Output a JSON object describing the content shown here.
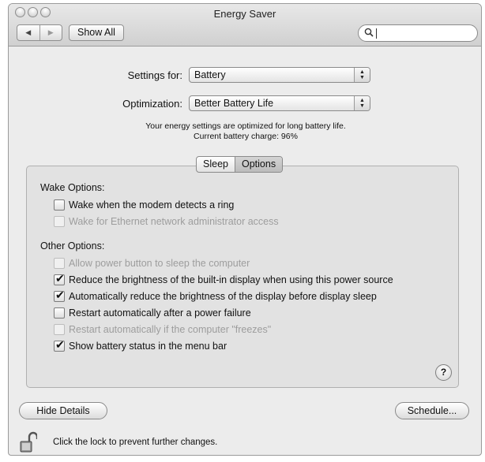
{
  "window": {
    "title": "Energy Saver"
  },
  "toolbar": {
    "back_icon": "back-arrow-icon",
    "forward_icon": "forward-arrow-icon",
    "show_all_label": "Show All",
    "search_placeholder": ""
  },
  "settings_for": {
    "label": "Settings for:",
    "value": "Battery"
  },
  "optimization": {
    "label": "Optimization:",
    "value": "Better Battery Life"
  },
  "info": {
    "line1": "Your energy settings are optimized for long battery life.",
    "line2": "Current battery charge: 96%"
  },
  "tabs": [
    {
      "label": "Sleep",
      "selected": false
    },
    {
      "label": "Options",
      "selected": true
    }
  ],
  "wake_options": {
    "title": "Wake Options:",
    "items": [
      {
        "label": "Wake when the modem detects a ring",
        "checked": false,
        "enabled": true
      },
      {
        "label": "Wake for Ethernet network administrator access",
        "checked": false,
        "enabled": false
      }
    ]
  },
  "other_options": {
    "title": "Other Options:",
    "items": [
      {
        "label": "Allow power button to sleep the computer",
        "checked": false,
        "enabled": false
      },
      {
        "label": "Reduce the brightness of the built-in display when using this power source",
        "checked": true,
        "enabled": true
      },
      {
        "label": "Automatically reduce the brightness of the display before display sleep",
        "checked": true,
        "enabled": true
      },
      {
        "label": "Restart automatically after a power failure",
        "checked": false,
        "enabled": true
      },
      {
        "label": "Restart automatically if the computer \"freezes\"",
        "checked": false,
        "enabled": false
      },
      {
        "label": "Show battery status in the menu bar",
        "checked": true,
        "enabled": true
      }
    ]
  },
  "help": {
    "label": "?"
  },
  "buttons": {
    "hide_details": "Hide Details",
    "schedule": "Schedule..."
  },
  "lock": {
    "icon": "lock-icon",
    "text": "Click the lock to prevent further changes."
  }
}
